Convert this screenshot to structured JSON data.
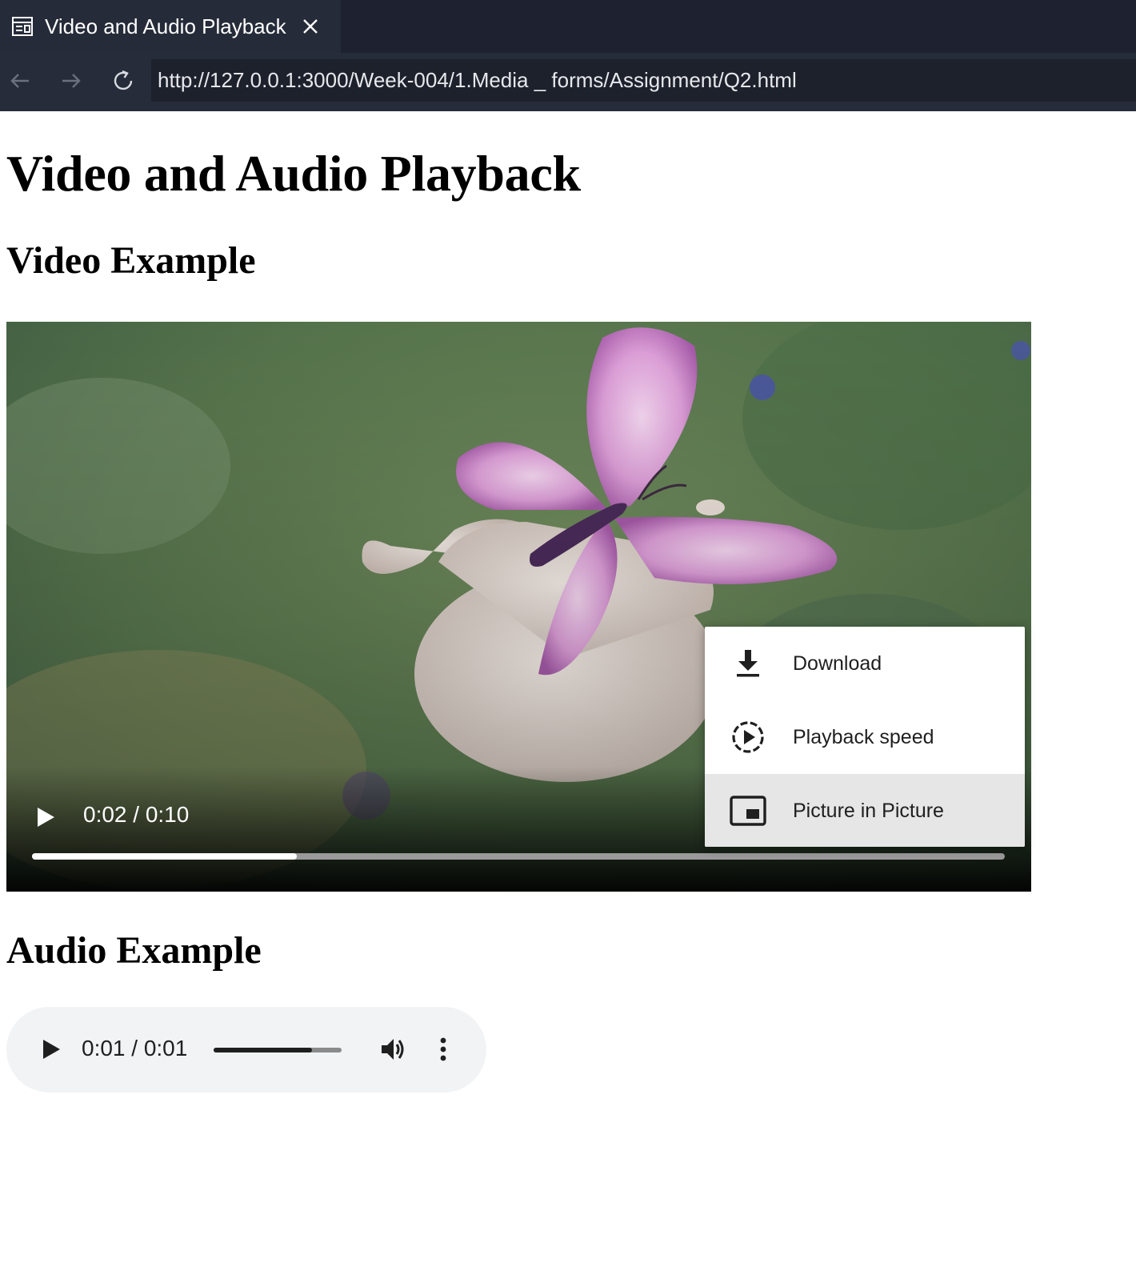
{
  "browser": {
    "tab_title": "Video and Audio Playback",
    "url": "http://127.0.0.1:3000/Week-004/1.Media _ forms/Assignment/Q2.html",
    "icons": {
      "page": "page-icon",
      "close": "close-icon",
      "back": "back-arrow-icon",
      "forward": "forward-arrow-icon",
      "reload": "reload-icon"
    }
  },
  "page": {
    "title": "Video and Audio Playback",
    "video_heading": "Video Example",
    "audio_heading": "Audio Example"
  },
  "video_player": {
    "time": "0:02 / 0:10",
    "progress": 0.272,
    "menu": [
      {
        "label": "Download",
        "icon": "download-icon"
      },
      {
        "label": "Playback speed",
        "icon": "playback-speed-icon"
      },
      {
        "label": "Picture in Picture",
        "icon": "picture-in-picture-icon",
        "highlighted": true
      }
    ]
  },
  "audio_player": {
    "time": "0:01 / 0:01",
    "progress": 0.77,
    "icons": {
      "play": "play-icon",
      "volume": "volume-icon",
      "more": "more-options-icon"
    }
  },
  "colors": {
    "tabbar": "#1e2230",
    "tab_active": "#262b39",
    "navbar": "#272c3a",
    "audio_bg": "#f1f3f4",
    "menu_highlight": "#e6e6e6"
  }
}
